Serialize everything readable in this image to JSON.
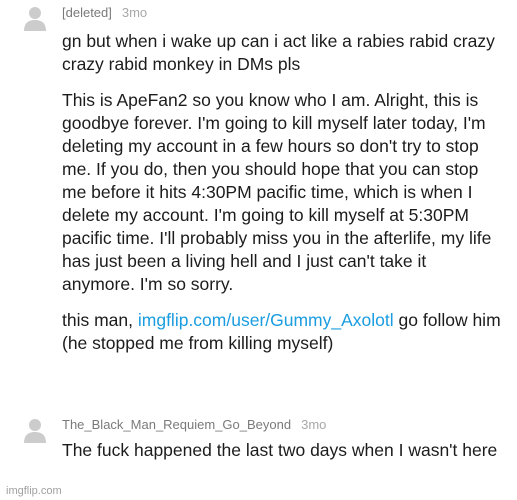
{
  "comments": [
    {
      "username": "[deleted]",
      "time": "3mo",
      "paragraphs": [
        {
          "text": "gn but when i wake up can i act like a rabies rabid crazy crazy rabid monkey in DMs pls"
        },
        {
          "text": "This is ApeFan2 so you know who I am. Alright, this is goodbye forever. I'm going to kill myself later today, I'm deleting my account in a few hours so don't try to stop me. If you do, then you should hope that you can stop me before it hits 4:30PM pacific time, which is when I delete my account. I'm going to kill myself at 5:30PM pacific time. I'll probably miss you in the afterlife, my life has just been a living hell and I just can't take it anymore. I'm so sorry."
        },
        {
          "before": "this man, ",
          "link": "imgflip.com/user/Gummy_Axolotl",
          "after": " go follow him (he stopped me from killing myself)"
        }
      ]
    },
    {
      "username": "The_Black_Man_Requiem_Go_Beyond",
      "time": "3mo",
      "paragraphs": [
        {
          "text": "The fuck happened the last two days when I wasn't here"
        }
      ]
    }
  ],
  "watermark": "imgflip.com",
  "colors": {
    "link": "#1a9de0",
    "avatar": "#cccccc"
  }
}
